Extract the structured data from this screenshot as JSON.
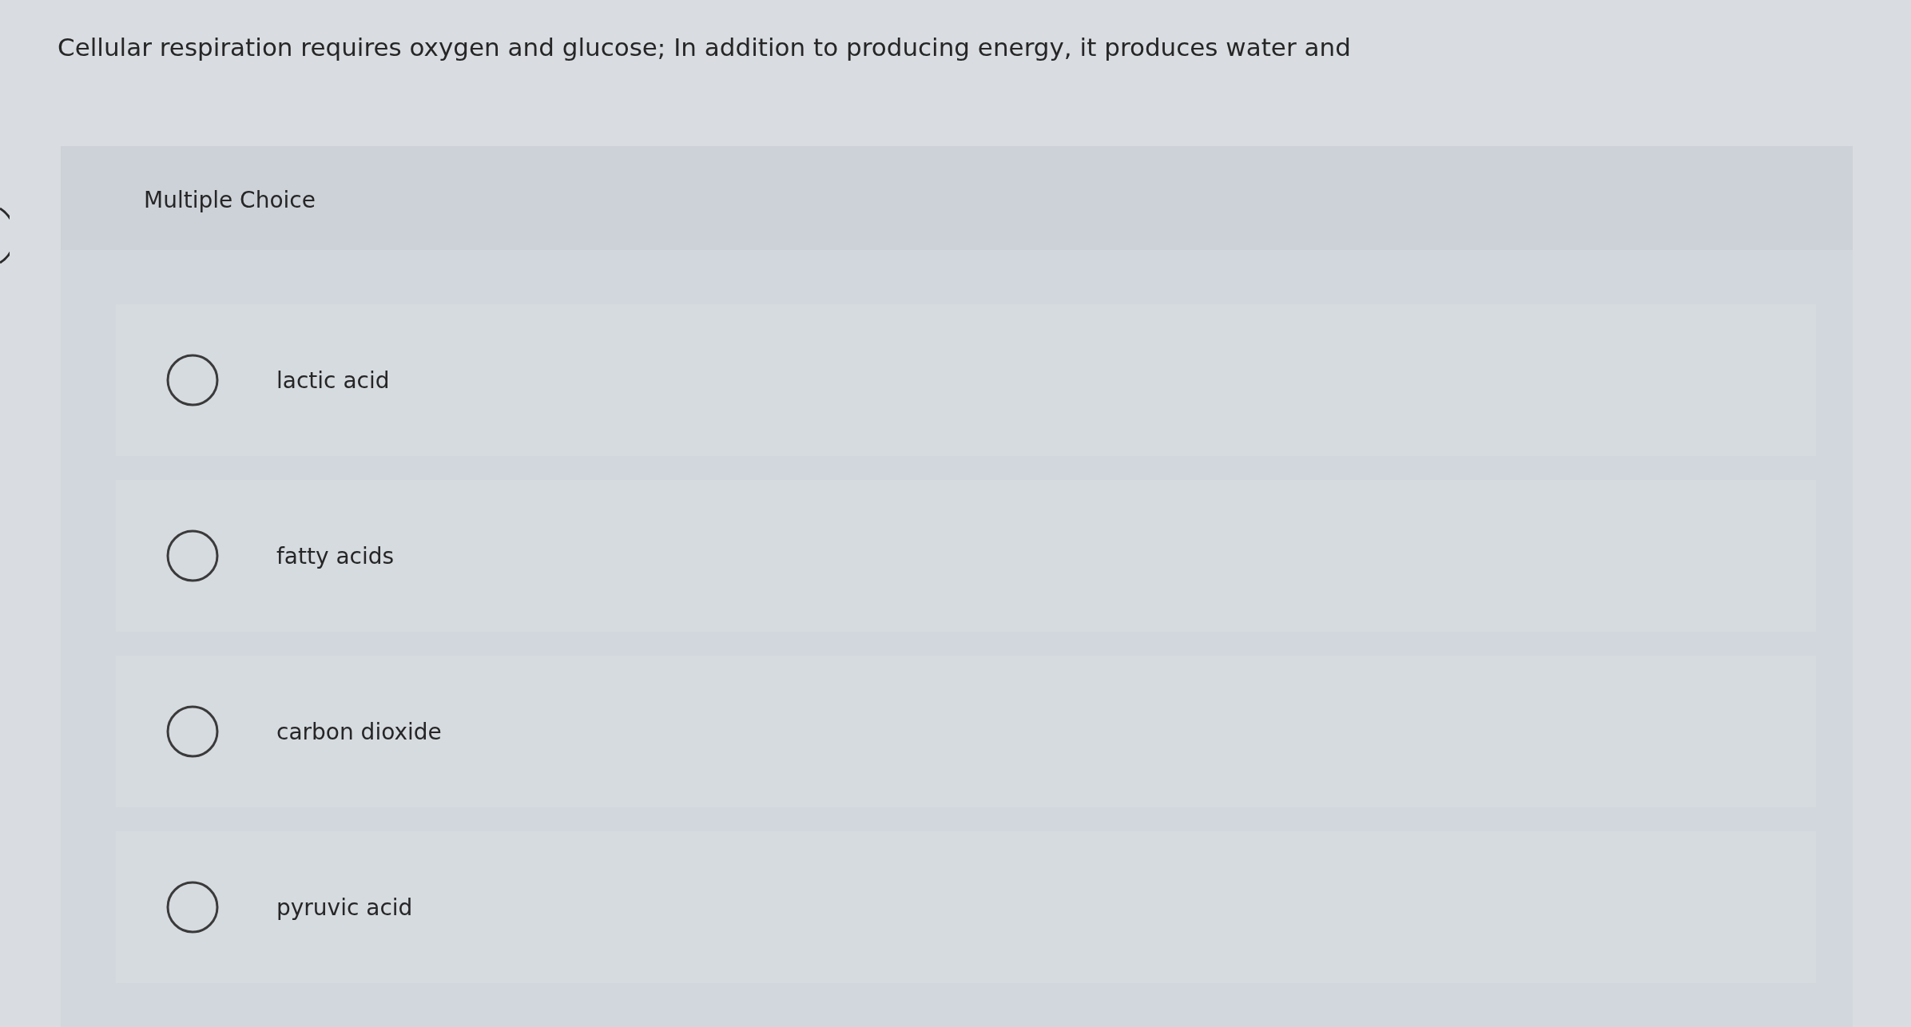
{
  "question": "Cellular respiration requires oxygen and glucose; In addition to producing energy, it produces water and",
  "panel": {
    "title": "Multiple Choice"
  },
  "options": [
    {
      "label": "lactic acid",
      "selected": false
    },
    {
      "label": "fatty acids",
      "selected": false
    },
    {
      "label": "carbon dioxide",
      "selected": false
    },
    {
      "label": "pyruvic acid",
      "selected": false
    }
  ]
}
